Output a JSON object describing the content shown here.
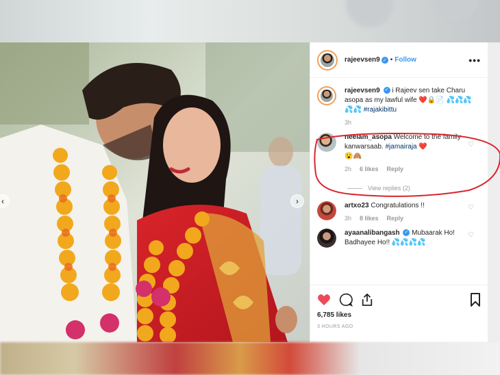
{
  "post": {
    "author": "rajeevsen9",
    "follow_label": "Follow",
    "more_label": "•••",
    "caption": {
      "username": "rajeevsen9",
      "text": "i Rajeev sen take Charu asopa as my lawful wife ❤️🔒📄 💦💦💦",
      "text2": "💦💦",
      "hashtag": "#rajakibittu",
      "time": "3h"
    },
    "comments": [
      {
        "username": "neelam_asopa",
        "text": "Welcome to the family kanwarsaab.",
        "hashtag": "#jamairaja",
        "emoji": "❤️",
        "line3": "😮🙈",
        "time": "2h",
        "likes": "6 likes",
        "reply": "Reply",
        "view_replies": "View replies (2)"
      },
      {
        "username": "artxo23",
        "text": "Congratulations !!",
        "time": "3h",
        "likes": "8 likes",
        "reply": "Reply"
      },
      {
        "username": "ayaanalibangash",
        "text": "Mubaarak Ho! Badhayee Ho!! 💦💦💦💦"
      }
    ],
    "likes": "6,785 likes",
    "time_ago": "3 HOURS AGO"
  },
  "icons": [
    "heart-icon",
    "comment-icon",
    "share-icon",
    "bookmark-icon",
    "more-icon",
    "chevron-left-icon",
    "chevron-right-icon",
    "verified-icon"
  ],
  "colors": {
    "verified": "#3897f0",
    "follow": "#3897f0",
    "liked_heart": "#ed4956",
    "annotation": "#d9242b"
  }
}
